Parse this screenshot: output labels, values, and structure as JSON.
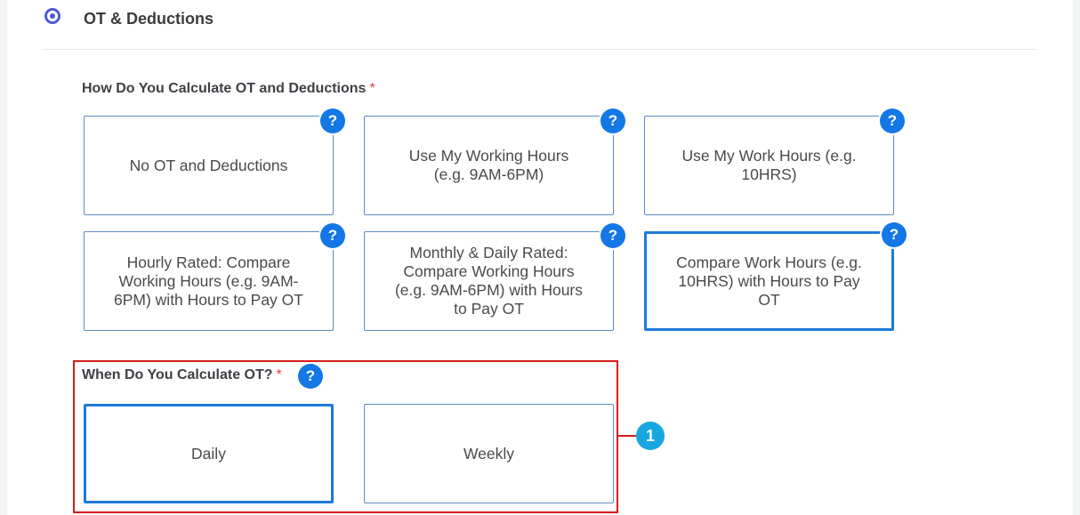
{
  "section": {
    "title": "OT & Deductions"
  },
  "calc_method": {
    "label": "How Do You Calculate OT and Deductions",
    "required_mark": "*",
    "help_glyph": "?",
    "options": [
      {
        "label": "No OT and Deductions"
      },
      {
        "label": "Use My Working Hours (e.g. 9AM-6PM)"
      },
      {
        "label": "Use My Work Hours (e.g. 10HRS)"
      },
      {
        "label": "Hourly Rated: Compare Working Hours (e.g. 9AM-6PM) with Hours to Pay OT"
      },
      {
        "label": "Monthly & Daily Rated: Compare Working Hours (e.g. 9AM-6PM) with Hours to Pay OT"
      },
      {
        "label": "Compare Work Hours (e.g. 10HRS) with Hours to Pay OT"
      }
    ],
    "selected": "Compare Work Hours (e.g. 10HRS) with Hours to Pay OT"
  },
  "calc_timing": {
    "label": "When Do You Calculate OT?",
    "required_mark": "*",
    "help_glyph": "?",
    "options": [
      {
        "label": "Daily"
      },
      {
        "label": "Weekly"
      }
    ],
    "selected": "Daily"
  },
  "annotation": {
    "badge": "1",
    "color": "#d61b1b",
    "badge_color": "#17a6e0"
  },
  "colors": {
    "accent": "#1377e6",
    "radio": "#4f5bd5",
    "selected_border": "#1e7ad9",
    "option_border": "#5b8cc6"
  },
  "icons": {
    "section_radio": "radio-selected-icon",
    "help": "question-circle-icon"
  }
}
